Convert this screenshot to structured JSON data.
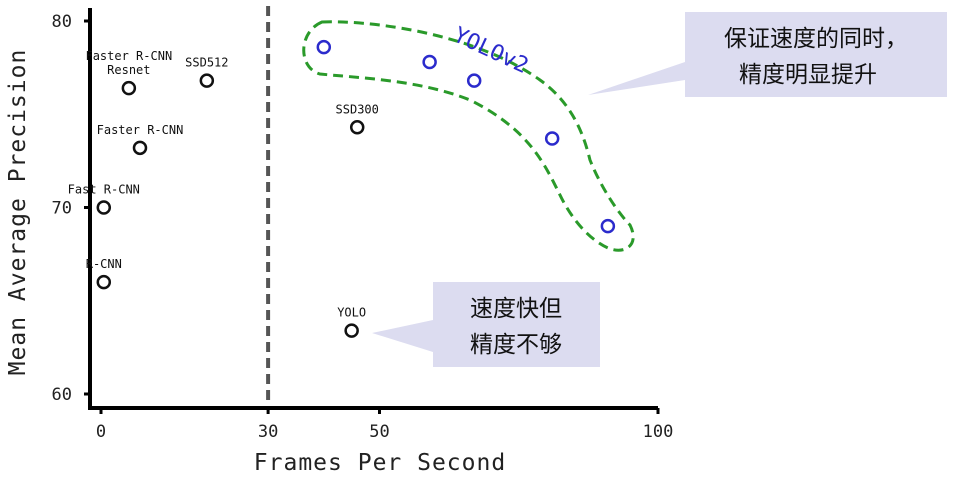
{
  "chart_data": {
    "type": "scatter",
    "xlabel": "Frames Per Second",
    "ylabel": "Mean Average Precision",
    "xlim": [
      -2,
      100
    ],
    "ylim": [
      59,
      81
    ],
    "x_ticks": [
      0,
      30,
      50,
      100
    ],
    "y_ticks": [
      60,
      70,
      80
    ],
    "x_tick_labels": [
      "0",
      "30",
      "50",
      "100"
    ],
    "y_tick_labels": [
      "60",
      "70",
      "80"
    ],
    "realtime_line_x": 30,
    "points": [
      {
        "label": "R-CNN",
        "x": 0.5,
        "y": 66.0,
        "color": "#111111"
      },
      {
        "label": "Fast R-CNN",
        "x": 0.5,
        "y": 70.0,
        "color": "#111111"
      },
      {
        "label": "Faster R-CNN",
        "x": 7,
        "y": 73.2,
        "color": "#111111"
      },
      {
        "label": "Faster R-CNN\nResnet",
        "x": 5,
        "y": 76.4,
        "color": "#111111"
      },
      {
        "label": "SSD512",
        "x": 19,
        "y": 76.8,
        "color": "#111111"
      },
      {
        "label": "SSD300",
        "x": 46,
        "y": 74.3,
        "color": "#111111"
      },
      {
        "label": "YOLO",
        "x": 45,
        "y": 63.4,
        "color": "#111111"
      }
    ],
    "series": [
      {
        "name": "YOLOv2",
        "color": "#2b2bcc",
        "points": [
          {
            "x": 40,
            "y": 78.6
          },
          {
            "x": 59,
            "y": 77.8
          },
          {
            "x": 67,
            "y": 76.8
          },
          {
            "x": 81,
            "y": 73.7
          },
          {
            "x": 91,
            "y": 69.0
          }
        ]
      }
    ]
  },
  "callouts": {
    "top": {
      "lines": [
        "保证速度的同时，",
        "精度明显提升"
      ],
      "fill": "#dcdcf0"
    },
    "bottom": {
      "lines": [
        "速度快但",
        "精度不够"
      ],
      "fill": "#dcdcf0"
    }
  },
  "colors": {
    "axis": "#000000",
    "yolo_v2": "#2b2bcc",
    "group_outline": "#2a9a2a",
    "divider": "#555555"
  }
}
